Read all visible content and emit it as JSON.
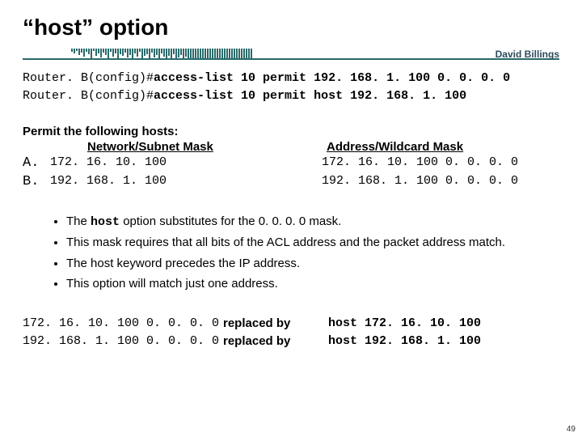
{
  "title": "“host” option",
  "author": "David Billings",
  "cmd1_prefix": "Router. B(config)#",
  "cmd1_body": "access-list 10 permit 192. 168. 1. 100 0. 0. 0. 0",
  "cmd2_prefix": "Router. B(config)#",
  "cmd2_body": "access-list 10 permit host 192. 168. 1. 100",
  "permit_header": "Permit the following hosts:",
  "col_left_header": "Network/Subnet Mask",
  "col_right_header": "Address/Wildcard Mask",
  "rowA": {
    "letter": "A.",
    "ip": "172. 16. 10. 100",
    "wild": "172. 16. 10. 100 0. 0. 0. 0"
  },
  "rowB": {
    "letter": "B.",
    "ip": "192. 168. 1. 100",
    "wild": "192. 168. 1. 100 0. 0. 0. 0"
  },
  "bullet1a": "The ",
  "bullet1_code": "host",
  "bullet1b": " option substitutes for the 0. 0. 0. 0 mask.",
  "bullet2": "This mask requires that all bits of the ACL address and the packet address match.",
  "bullet3": "The host keyword precedes the IP address.",
  "bullet4": "This option will match just one address.",
  "rep1": {
    "left": "172. 16. 10. 100 0. 0. 0. 0",
    "mid": "replaced by",
    "right": "host 172. 16. 10. 100"
  },
  "rep2": {
    "left": "192. 168. 1. 100 0. 0. 0. 0",
    "mid": "replaced by",
    "right": "host 192. 168. 1. 100"
  },
  "page_num": "49"
}
